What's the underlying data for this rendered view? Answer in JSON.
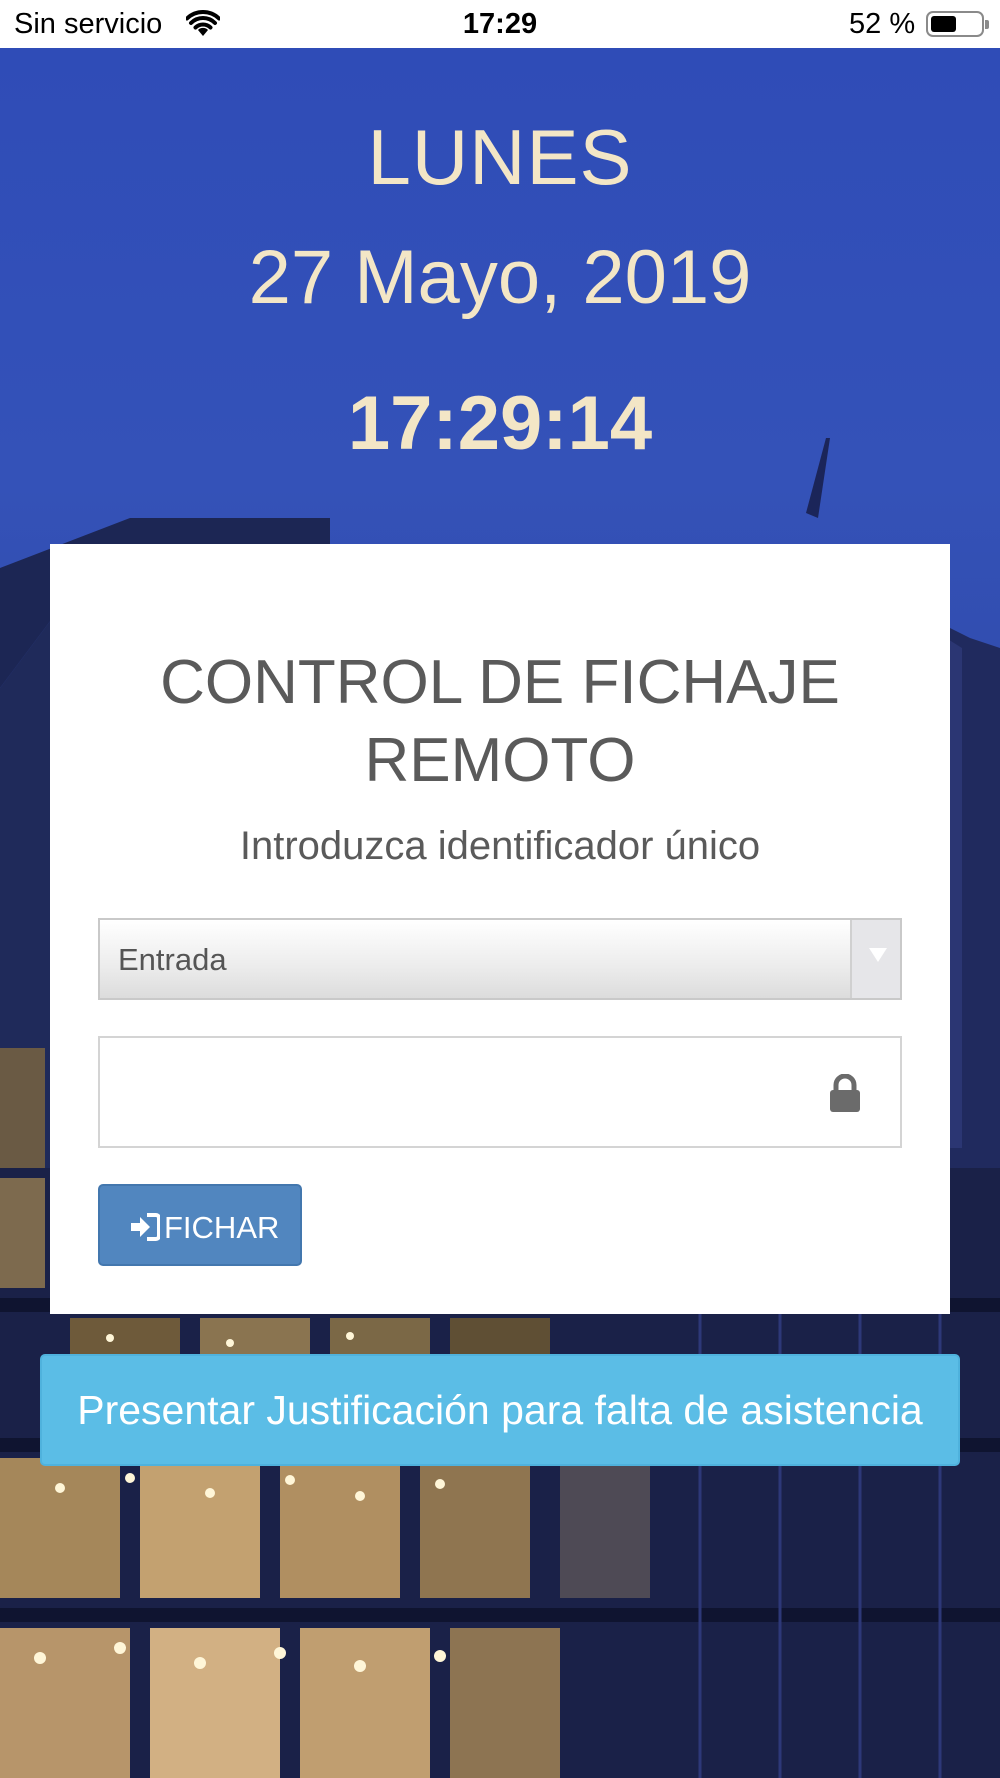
{
  "status_bar": {
    "carrier": "Sin servicio",
    "time": "17:29",
    "battery_percent_label": "52 %",
    "battery_level": 0.52
  },
  "header": {
    "day": "LUNES",
    "date": "27 Mayo, 2019",
    "time": "17:29:14"
  },
  "card": {
    "title": "CONTROL DE FICHAJE REMOTO",
    "subtitle": "Introduzca identificador único",
    "select": {
      "selected": "Entrada"
    },
    "identifier_input": {
      "value": "",
      "icon": "lock-icon"
    },
    "submit": {
      "label": "FICHAR",
      "icon": "sign-in-icon"
    }
  },
  "justification_button": {
    "label": "Presentar Justificación para falta de asistencia"
  },
  "colors": {
    "accent_text": "#f3e6c6",
    "primary_button": "#5186bf",
    "info_button": "#5bbde6",
    "card_text": "#5a5a5a"
  }
}
